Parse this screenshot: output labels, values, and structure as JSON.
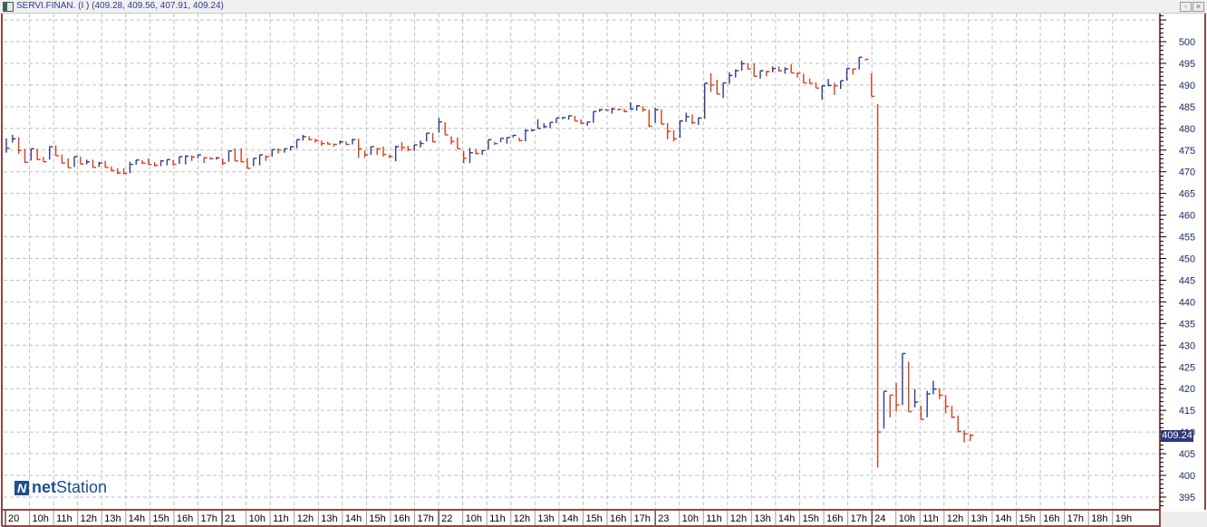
{
  "window": {
    "title": "SERVI.FINAN. (I ) (409.28, 409.56, 407.91, 409.24)",
    "buttons": [
      "restore",
      "close"
    ]
  },
  "logo": {
    "mark": "N",
    "part1": "net",
    "part2": "Station"
  },
  "last_price_label": "409.24",
  "colors": {
    "up": "#2e3a87",
    "down": "#d0401a",
    "frame": "#8b4848",
    "grid": "#c0c0c0",
    "axis_text": "#1a2a6c",
    "price_box": "#2e3a7a"
  },
  "chart_data": {
    "type": "ohlc-bar",
    "bar_format": [
      "high",
      "low",
      "close"
    ],
    "ylim": [
      393,
      506
    ],
    "yticks": [
      395,
      400,
      405,
      410,
      415,
      420,
      425,
      430,
      435,
      440,
      445,
      450,
      455,
      460,
      465,
      470,
      475,
      480,
      485,
      490,
      495,
      500
    ],
    "grid": true,
    "xtick_labels": [
      "20",
      "10h",
      "11h",
      "12h",
      "13h",
      "14h",
      "15h",
      "16h",
      "17h",
      "21",
      "10h",
      "11h",
      "12h",
      "13h",
      "14h",
      "15h",
      "16h",
      "17h",
      "22",
      "10h",
      "11h",
      "12h",
      "13h",
      "14h",
      "15h",
      "16h",
      "17h",
      "23",
      "10h",
      "11h",
      "12h",
      "13h",
      "14h",
      "15h",
      "16h",
      "17h",
      "24",
      "10h",
      "11h",
      "12h",
      "13h",
      "14h",
      "15h",
      "16h",
      "17h",
      "18h",
      "19h"
    ],
    "last_bar": {
      "open": 409.28,
      "high": 409.56,
      "low": 407.91,
      "close": 409.24
    },
    "bars": [
      [
        477.7,
        474.4,
        475.4
      ],
      [
        478.5,
        476.7,
        477.6
      ],
      [
        477.9,
        474.1,
        474.9
      ],
      [
        475.3,
        472.0,
        472.2
      ],
      [
        475.3,
        472.6,
        475.3
      ],
      [
        475.3,
        472.8,
        472.8
      ],
      [
        473.4,
        472.3,
        472.3
      ],
      [
        475.8,
        472.8,
        475.8
      ],
      [
        476.1,
        473.7,
        473.7
      ],
      [
        474.0,
        472.0,
        472.0
      ],
      [
        473.1,
        470.9,
        470.9
      ],
      [
        473.5,
        471.1,
        473.5
      ],
      [
        473.5,
        471.7,
        471.8
      ],
      [
        472.8,
        471.7,
        472.3
      ],
      [
        472.8,
        471.0,
        471.0
      ],
      [
        472.3,
        471.1,
        472.0
      ],
      [
        472.5,
        471.0,
        471.0
      ],
      [
        471.2,
        470.1,
        470.3
      ],
      [
        470.8,
        469.5,
        469.7
      ],
      [
        470.8,
        469.5,
        469.6
      ],
      [
        472.3,
        469.7,
        471.7
      ],
      [
        472.7,
        471.6,
        472.7
      ],
      [
        472.7,
        471.8,
        472.0
      ],
      [
        473.1,
        471.6,
        471.7
      ],
      [
        472.2,
        471.2,
        471.5
      ],
      [
        472.7,
        471.3,
        472.5
      ],
      [
        472.8,
        471.5,
        472.8
      ],
      [
        472.7,
        471.5,
        471.7
      ],
      [
        473.5,
        471.8,
        473.5
      ],
      [
        473.8,
        471.7,
        473.6
      ],
      [
        473.8,
        472.5,
        473.4
      ],
      [
        473.9,
        473.1,
        473.9
      ],
      [
        473.4,
        472.0,
        473.2
      ],
      [
        473.4,
        472.8,
        473.0
      ],
      [
        473.4,
        472.8,
        473.2
      ],
      [
        473.1,
        471.5,
        472.0
      ],
      [
        474.8,
        472.3,
        474.8
      ],
      [
        475.4,
        472.5,
        472.5
      ],
      [
        475.4,
        472.2,
        472.3
      ],
      [
        473.2,
        470.8,
        470.8
      ],
      [
        473.1,
        471.3,
        473.1
      ],
      [
        474.0,
        471.5,
        473.9
      ],
      [
        473.8,
        472.5,
        473.5
      ],
      [
        475.1,
        473.5,
        475.1
      ],
      [
        475.4,
        474.2,
        475.0
      ],
      [
        475.3,
        474.4,
        475.3
      ],
      [
        475.9,
        474.9,
        475.8
      ],
      [
        477.4,
        475.4,
        477.4
      ],
      [
        478.5,
        477.2,
        478.1
      ],
      [
        478.2,
        477.2,
        477.4
      ],
      [
        477.6,
        476.7,
        477.2
      ],
      [
        477.2,
        476.0,
        476.5
      ],
      [
        476.9,
        476.3,
        476.4
      ],
      [
        476.5,
        475.8,
        476.3
      ],
      [
        477.2,
        476.3,
        476.9
      ],
      [
        477.0,
        476.2,
        476.3
      ],
      [
        477.6,
        476.3,
        477.4
      ],
      [
        477.6,
        473.2,
        475.3
      ],
      [
        474.9,
        473.2,
        473.9
      ],
      [
        475.8,
        473.9,
        475.8
      ],
      [
        475.5,
        473.9,
        475.3
      ],
      [
        475.8,
        473.5,
        474.0
      ],
      [
        473.9,
        473.1,
        473.5
      ],
      [
        476.0,
        472.4,
        475.8
      ],
      [
        476.8,
        474.8,
        475.6
      ],
      [
        476.0,
        474.7,
        475.1
      ],
      [
        476.2,
        474.8,
        476.2
      ],
      [
        477.2,
        475.6,
        476.5
      ],
      [
        478.9,
        477.0,
        478.9
      ],
      [
        478.9,
        476.8,
        476.9
      ],
      [
        482.4,
        479.0,
        481.5
      ],
      [
        481.4,
        478.5,
        478.5
      ],
      [
        478.2,
        476.3,
        477.0
      ],
      [
        477.9,
        475.3,
        475.3
      ],
      [
        474.8,
        472.0,
        473.1
      ],
      [
        475.5,
        472.0,
        474.4
      ],
      [
        475.3,
        474.0,
        474.2
      ],
      [
        474.9,
        473.9,
        474.9
      ],
      [
        477.4,
        475.1,
        477.4
      ],
      [
        476.8,
        476.2,
        476.5
      ],
      [
        477.7,
        476.8,
        477.7
      ],
      [
        477.9,
        476.5,
        477.9
      ],
      [
        478.5,
        477.9,
        478.4
      ],
      [
        477.9,
        477.0,
        477.2
      ],
      [
        479.8,
        477.0,
        479.5
      ],
      [
        479.8,
        479.3,
        479.6
      ],
      [
        482.1,
        480.0,
        480.0
      ],
      [
        481.2,
        480.1,
        480.4
      ],
      [
        481.4,
        480.1,
        481.4
      ],
      [
        482.4,
        481.2,
        482.4
      ],
      [
        482.6,
        482.1,
        482.5
      ],
      [
        482.9,
        482.0,
        482.9
      ],
      [
        482.9,
        481.7,
        481.7
      ],
      [
        482.1,
        481.0,
        481.2
      ],
      [
        481.5,
        480.6,
        481.5
      ],
      [
        483.9,
        481.3,
        483.9
      ],
      [
        484.5,
        483.8,
        484.3
      ],
      [
        484.5,
        484.1,
        484.2
      ],
      [
        484.8,
        483.4,
        484.5
      ],
      [
        484.5,
        484.1,
        484.4
      ],
      [
        484.5,
        483.7,
        483.9
      ],
      [
        486.0,
        484.3,
        484.5
      ],
      [
        485.3,
        484.1,
        485.2
      ],
      [
        485.1,
        483.8,
        484.3
      ],
      [
        484.3,
        480.3,
        480.5
      ],
      [
        484.8,
        481.3,
        484.3
      ],
      [
        484.4,
        481.0,
        481.0
      ],
      [
        481.2,
        477.5,
        479.3
      ],
      [
        479.6,
        477.0,
        477.6
      ],
      [
        481.9,
        477.8,
        481.7
      ],
      [
        483.6,
        481.5,
        482.7
      ],
      [
        483.2,
        481.0,
        481.3
      ],
      [
        482.5,
        480.8,
        482.4
      ],
      [
        490.4,
        482.2,
        490.4
      ],
      [
        492.7,
        488.4,
        490.0
      ],
      [
        491.2,
        487.9,
        487.9
      ],
      [
        490.5,
        487.0,
        490.5
      ],
      [
        492.9,
        490.3,
        492.2
      ],
      [
        493.6,
        491.7,
        493.3
      ],
      [
        495.6,
        493.3,
        494.9
      ],
      [
        495.0,
        493.6,
        493.7
      ],
      [
        495.0,
        492.0,
        492.0
      ],
      [
        493.3,
        491.5,
        493.3
      ],
      [
        493.3,
        492.0,
        493.1
      ],
      [
        494.3,
        492.9,
        493.8
      ],
      [
        494.3,
        493.1,
        493.3
      ],
      [
        494.1,
        492.6,
        493.7
      ],
      [
        494.8,
        492.8,
        492.8
      ],
      [
        492.9,
        491.7,
        492.7
      ],
      [
        492.6,
        490.5,
        490.5
      ],
      [
        491.5,
        490.3,
        490.4
      ],
      [
        490.6,
        489.3,
        489.3
      ],
      [
        489.9,
        486.6,
        489.8
      ],
      [
        491.4,
        489.7,
        489.9
      ],
      [
        490.5,
        487.7,
        489.8
      ],
      [
        491.0,
        489.1,
        491.0
      ],
      [
        493.8,
        491.0,
        493.8
      ],
      [
        493.8,
        492.4,
        493.7
      ],
      [
        496.4,
        493.6,
        496.4
      ],
      [
        495.9,
        495.9,
        495.9
      ],
      [
        492.7,
        487.4,
        487.4
      ],
      [
        485.6,
        401.8,
        410.0
      ],
      [
        419.4,
        410.8,
        419.4
      ],
      [
        418.5,
        413.4,
        418.5
      ],
      [
        421.3,
        414.7,
        416.2
      ],
      [
        428.1,
        416.2,
        428.1
      ],
      [
        426.2,
        414.7,
        414.7
      ],
      [
        419.9,
        415.7,
        416.9
      ],
      [
        416.1,
        412.9,
        412.9
      ],
      [
        419.5,
        413.4,
        418.8
      ],
      [
        421.8,
        418.7,
        419.9
      ],
      [
        420.1,
        417.6,
        418.5
      ],
      [
        418.5,
        414.3,
        415.9
      ],
      [
        416.0,
        413.2,
        413.4
      ],
      [
        413.8,
        409.9,
        410.1
      ],
      [
        410.4,
        407.6,
        409.6
      ],
      [
        409.56,
        407.91,
        409.24
      ]
    ]
  }
}
